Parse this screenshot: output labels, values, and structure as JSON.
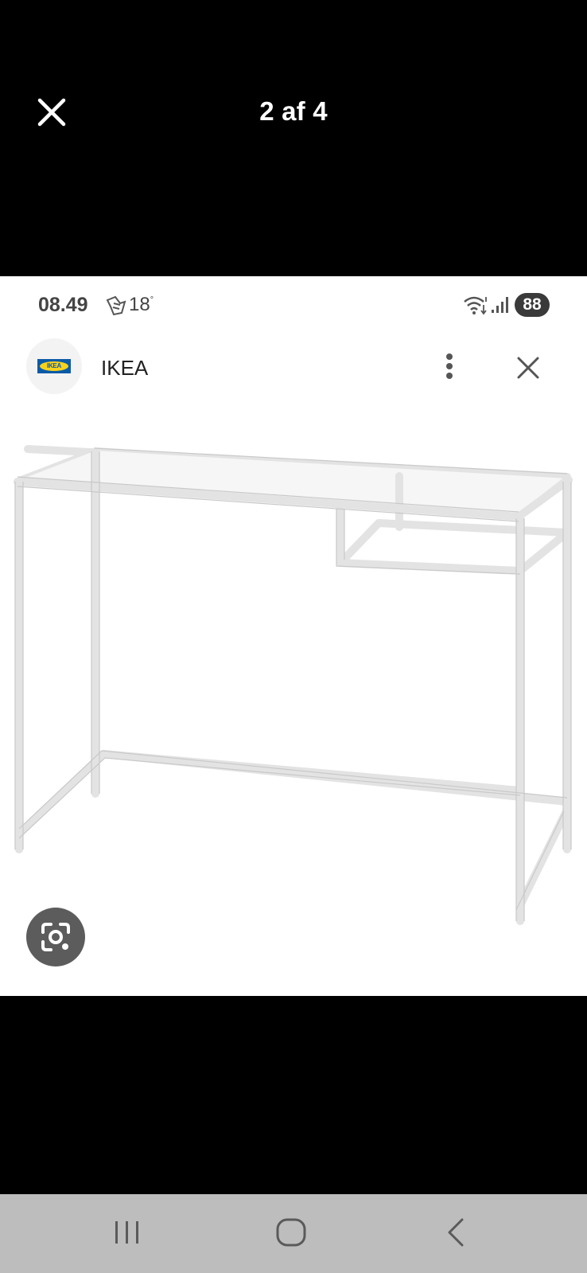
{
  "viewer": {
    "counter": "2 af 4",
    "close_icon": "close-icon"
  },
  "status_bar": {
    "time": "08.49",
    "temperature": "18",
    "temperature_unit": "°",
    "battery": "88",
    "icons": [
      "notification-icon",
      "wifi-icon",
      "signal-icon"
    ]
  },
  "app_bar": {
    "logo_text": "IKEA",
    "title": "IKEA",
    "more_icon": "more-vert-icon",
    "close_icon": "close-icon"
  },
  "product_image": {
    "subject": "white-console-table"
  },
  "lens_button": {
    "icon": "lens-search-icon"
  },
  "nav_bar": {
    "buttons": [
      "recents-icon",
      "home-icon",
      "back-icon"
    ]
  },
  "colors": {
    "background": "#000000",
    "screenshot_bg": "#ffffff",
    "nav_bar": "#bdbdbd",
    "ikea_blue": "#0b5aa8",
    "ikea_yellow": "#f8d21c"
  }
}
